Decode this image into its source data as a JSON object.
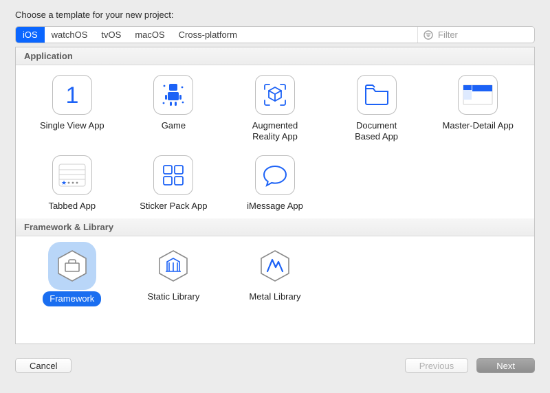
{
  "prompt": "Choose a template for your new project:",
  "colors": {
    "accent": "#1a6ef0",
    "iconBlue": "#1c62f6"
  },
  "tabs": [
    {
      "label": "iOS",
      "active": true
    },
    {
      "label": "watchOS",
      "active": false
    },
    {
      "label": "tvOS",
      "active": false
    },
    {
      "label": "macOS",
      "active": false
    },
    {
      "label": "Cross-platform",
      "active": false
    }
  ],
  "filter": {
    "placeholder": "Filter",
    "value": ""
  },
  "sections": [
    {
      "title": "Application",
      "templates": [
        {
          "name": "Single View App",
          "icon": "single-view",
          "selected": false
        },
        {
          "name": "Game",
          "icon": "game",
          "selected": false
        },
        {
          "name": "Augmented\nReality App",
          "icon": "arkit",
          "selected": false
        },
        {
          "name": "Document\nBased App",
          "icon": "document",
          "selected": false
        },
        {
          "name": "Master-Detail App",
          "icon": "master-detail",
          "selected": false
        },
        {
          "name": "Tabbed App",
          "icon": "tabbed",
          "selected": false
        },
        {
          "name": "Sticker Pack App",
          "icon": "sticker",
          "selected": false
        },
        {
          "name": "iMessage App",
          "icon": "imessage",
          "selected": false
        }
      ]
    },
    {
      "title": "Framework & Library",
      "templates": [
        {
          "name": "Framework",
          "icon": "framework",
          "selected": true
        },
        {
          "name": "Static Library",
          "icon": "static-library",
          "selected": false
        },
        {
          "name": "Metal Library",
          "icon": "metal-library",
          "selected": false
        }
      ]
    }
  ],
  "buttons": {
    "cancel": "Cancel",
    "previous": "Previous",
    "next": "Next"
  }
}
